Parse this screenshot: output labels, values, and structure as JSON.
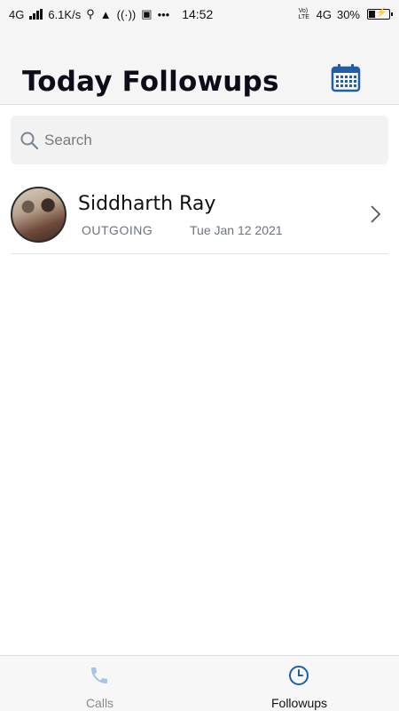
{
  "status_bar": {
    "network": "4G",
    "speed": "6.1K/s",
    "time": "14:52",
    "volte": "Vo) LTE",
    "network_right": "4G",
    "battery": "30%"
  },
  "header": {
    "title": "Today Followups",
    "calendar_icon": "calendar-icon"
  },
  "search": {
    "placeholder": "Search",
    "value": ""
  },
  "followups": [
    {
      "name": "Siddharth Ray",
      "direction": "OUTGOING",
      "date": "Tue Jan 12 2021"
    }
  ],
  "tabs": [
    {
      "label": "Calls",
      "icon": "phone-icon",
      "active": false
    },
    {
      "label": "Followups",
      "icon": "clock-icon",
      "active": true
    }
  ],
  "colors": {
    "accent": "#1f5fa8",
    "inactive_tab_icon": "#a8c4e4",
    "secondary_text": "#6c7480"
  }
}
